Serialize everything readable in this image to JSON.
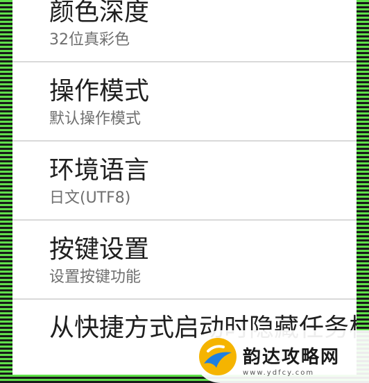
{
  "settings": {
    "items": [
      {
        "title": "颜色深度",
        "subtitle": "32位真彩色"
      },
      {
        "title": "操作模式",
        "subtitle": "默认操作模式"
      },
      {
        "title": "环境语言",
        "subtitle": "日文(UTF8)"
      },
      {
        "title": "按键设置",
        "subtitle": "设置按键功能"
      },
      {
        "title": "从快捷方式启动时隐藏任务栏"
      }
    ]
  },
  "watermark": {
    "brand": "韵达攻略网",
    "url": "www.ydfcy.com"
  },
  "colors": {
    "frame_stripe_green": "#5fe04a",
    "frame_stripe_dark": "#1a1a1a",
    "logo_yellow": "#f5b400",
    "logo_blue": "#1f7fe0"
  }
}
